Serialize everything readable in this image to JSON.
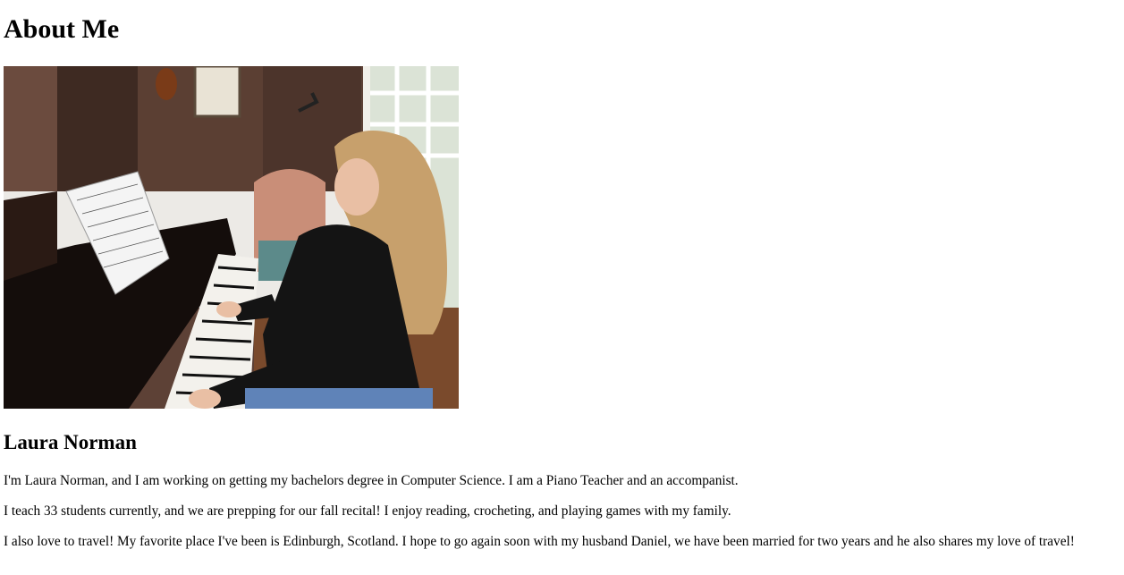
{
  "page": {
    "heading": "About Me",
    "photo_alt": "Laura Norman playing the piano",
    "name": "Laura Norman",
    "paragraphs": [
      "I'm Laura Norman, and I am working on getting my bachelors degree in Computer Science. I am a Piano Teacher and an accompanist.",
      "I teach 33 students currently, and we are prepping for our fall recital! I enjoy reading, crocheting, and playing games with my family.",
      "I also love to travel! My favorite place I've been is Edinburgh, Scotland. I hope to go again soon with my husband Daniel, we have been married for two years and he also shares my love of travel!"
    ]
  }
}
